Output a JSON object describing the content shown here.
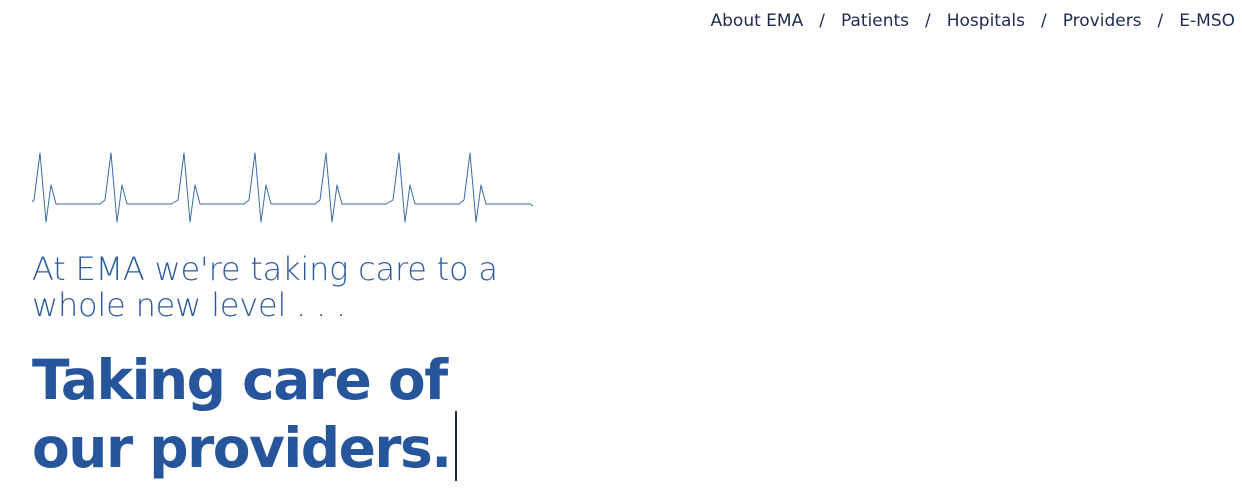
{
  "nav": {
    "items": [
      {
        "label": "About EMA"
      },
      {
        "label": "Patients"
      },
      {
        "label": "Hospitals"
      },
      {
        "label": "Providers"
      },
      {
        "label": "E-MSO"
      }
    ],
    "separator": "/"
  },
  "hero": {
    "tagline_line1": "At EMA we're taking care to a",
    "tagline_line2": "whole new level . . .",
    "headline_line1": "Taking care of",
    "headline_line2": "our providers."
  },
  "icons": {
    "heartbeat": "heartbeat-line-icon"
  },
  "colors": {
    "nav_text": "#1d2b4f",
    "tagline": "#2f5a9e",
    "headline": "#27559c",
    "heartbeat_line": "#3b6aa8"
  }
}
